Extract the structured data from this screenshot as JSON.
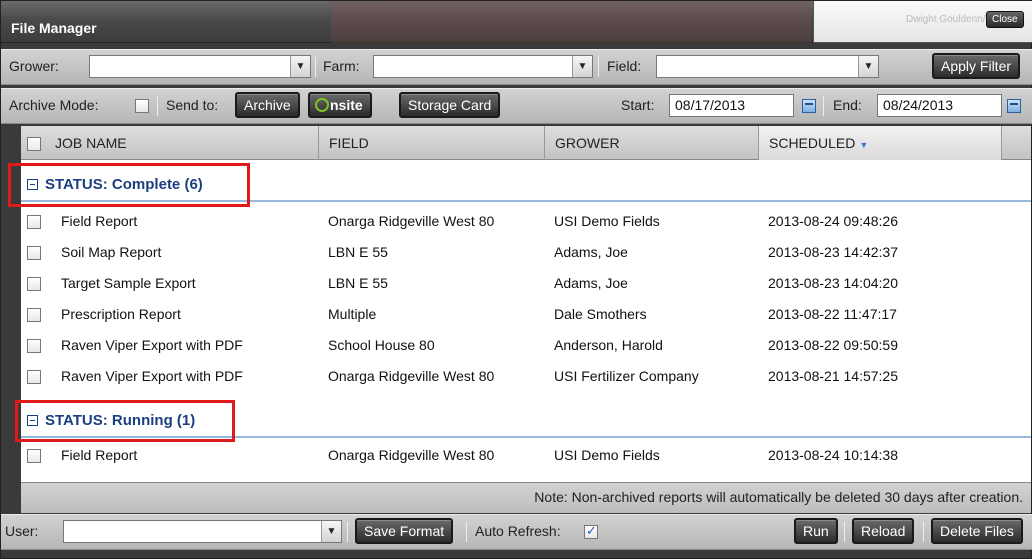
{
  "window": {
    "title": "File Manager"
  },
  "popup": {
    "faded_text": "Dwight Gouldenn/Twp",
    "close_label": "Close"
  },
  "filters": {
    "grower_label": "Grower:",
    "grower_value": "",
    "farm_label": "Farm:",
    "farm_value": "",
    "field_label": "Field:",
    "field_value": "",
    "apply_label": "Apply Filter"
  },
  "toolbar": {
    "archive_mode_label": "Archive Mode:",
    "send_to_label": "Send to:",
    "archive_button": "Archive",
    "onsite_button": "nsite",
    "storage_card_button": "Storage Card",
    "start_label": "Start:",
    "start_value": "08/17/2013",
    "end_label": "End:",
    "end_value": "08/24/2013"
  },
  "columns": [
    "JOB NAME",
    "FIELD",
    "GROWER",
    "SCHEDULED"
  ],
  "groups": [
    {
      "title": "STATUS: Complete (6)",
      "rows": [
        [
          "Field Report",
          "Onarga Ridgeville West 80",
          "USI Demo Fields",
          "2013-08-24 09:48:26"
        ],
        [
          "Soil Map Report",
          "LBN E 55",
          "Adams, Joe",
          "2013-08-23 14:42:37"
        ],
        [
          "Target Sample Export",
          "LBN E 55",
          "Adams, Joe",
          "2013-08-23 14:04:20"
        ],
        [
          "Prescription Report",
          "Multiple",
          "Dale Smothers",
          "2013-08-22 11:47:17"
        ],
        [
          "Raven Viper Export with PDF",
          "School House 80",
          "Anderson, Harold",
          "2013-08-22 09:50:59"
        ],
        [
          "Raven Viper Export with PDF",
          "Onarga Ridgeville West 80",
          "USI Fertilizer Company",
          "2013-08-21 14:57:25"
        ]
      ]
    },
    {
      "title": "STATUS: Running (1)",
      "rows": [
        [
          "Field Report",
          "Onarga Ridgeville West 80",
          "USI Demo Fields",
          "2013-08-24 10:14:38"
        ]
      ]
    }
  ],
  "note": "Note: Non-archived reports will automatically be deleted 30 days after creation.",
  "bottom": {
    "user_label": "User:",
    "user_value": "",
    "save_format": "Save Format",
    "auto_refresh_label": "Auto Refresh:",
    "auto_refresh_checked": true,
    "run": "Run",
    "reload": "Reload",
    "delete_files": "Delete Files"
  }
}
